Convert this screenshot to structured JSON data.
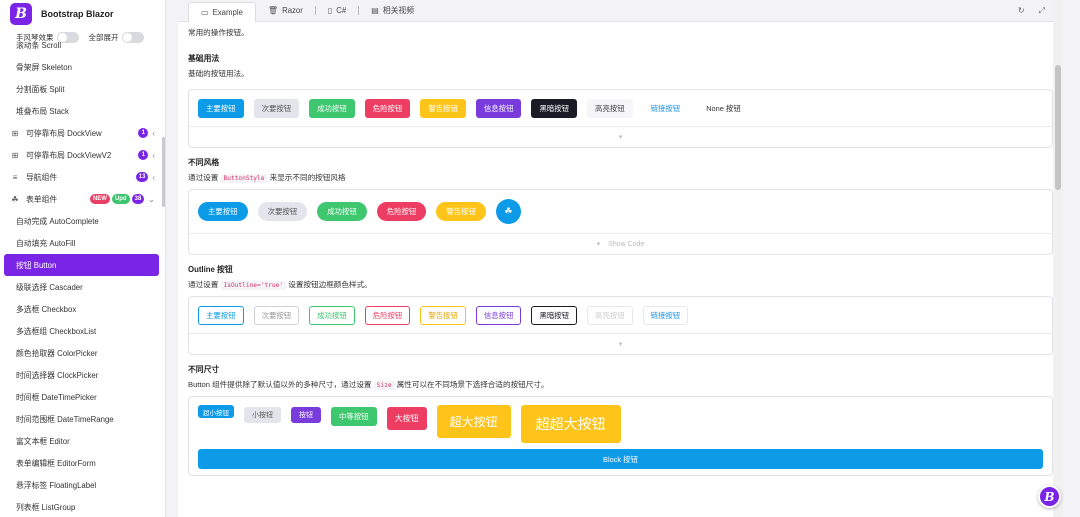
{
  "brand": {
    "logo": "B",
    "title": "Bootstrap Blazor"
  },
  "toggles": [
    {
      "label": "手风琴效果"
    },
    {
      "label": "全部展开"
    }
  ],
  "sidebar": {
    "items": [
      {
        "label": "滚动条 Scroll"
      },
      {
        "label": "骨架屏 Skeleton"
      },
      {
        "label": "分割面板 Split"
      },
      {
        "label": "堆叠布局 Stack"
      },
      {
        "label": "可停靠布局 DockView",
        "icon": "grid-icon",
        "badge": "1"
      },
      {
        "label": "可停靠布局 DockViewV2",
        "icon": "grid-icon",
        "badge": "1"
      },
      {
        "label": "导航组件",
        "icon": "list-icon",
        "badge": "13"
      },
      {
        "label": "表单组件",
        "icon": "cubes-icon",
        "badges": [
          "NEW",
          "Upd",
          "38"
        ]
      },
      {
        "label": "自动完成 AutoComplete"
      },
      {
        "label": "自动填充 AutoFill"
      },
      {
        "label": "按钮 Button",
        "active": true
      },
      {
        "label": "级联选择 Cascader"
      },
      {
        "label": "多选框 Checkbox"
      },
      {
        "label": "多选框组 CheckboxList"
      },
      {
        "label": "颜色拾取器 ColorPicker"
      },
      {
        "label": "时间选择器 ClockPicker"
      },
      {
        "label": "时间框 DateTimePicker"
      },
      {
        "label": "时间范围框 DateTimeRange"
      },
      {
        "label": "富文本框 Editor"
      },
      {
        "label": "表单编辑框 EditorForm"
      },
      {
        "label": "悬浮标签 FloatingLabel"
      },
      {
        "label": "列表框 ListGroup"
      }
    ]
  },
  "tabs": [
    {
      "label": "Example",
      "icon": "monitor-icon",
      "active": true
    },
    {
      "label": "Razor",
      "icon": "trash-icon"
    },
    {
      "label": "C#",
      "icon": "file-icon"
    },
    {
      "label": "相关视频",
      "icon": "video-icon"
    }
  ],
  "intro": "常用的操作按钮。",
  "sections": {
    "basic": {
      "title": "基础用法",
      "desc": "基础的按钮用法。",
      "buttons": [
        "主要按钮",
        "次要按钮",
        "成功按钮",
        "危险按钮",
        "警告按钮",
        "信息按钮",
        "黑暗按钮",
        "高亮按钮",
        "链接按钮",
        "None 按钮"
      ]
    },
    "style": {
      "title": "不同风格",
      "desc_pre": "通过设置",
      "code": "ButtonStyle",
      "desc_post": "来显示不同的按钮风格",
      "buttons": [
        "主要按钮",
        "次要按钮",
        "成功按钮",
        "危险按钮",
        "警告按钮"
      ],
      "show_code": "Show Code"
    },
    "outline": {
      "title": "Outline 按钮",
      "desc_pre": "通过设置",
      "code": "IsOutline='true'",
      "desc_post": "设置按钮边框颜色样式。",
      "buttons": [
        "主要按钮",
        "次要按钮",
        "成功按钮",
        "危险按钮",
        "警告按钮",
        "信息按钮",
        "黑暗按钮",
        "高亮按钮",
        "链接按钮"
      ]
    },
    "size": {
      "title": "不同尺寸",
      "desc_pre": "Button 组件提供除了默认值以外的多种尺寸，通过设置",
      "code": "Size",
      "desc_post": "属性可以在不同场景下选择合适的按钮尺寸。",
      "buttons": [
        "超小按钮",
        "小按钮",
        "按钮",
        "中等按钮",
        "大按钮",
        "超大按钮",
        "超超大按钮"
      ],
      "block": "Block 按钮"
    }
  },
  "colors": {
    "accent": "#7a25e6",
    "primary": "#0d9be8"
  }
}
